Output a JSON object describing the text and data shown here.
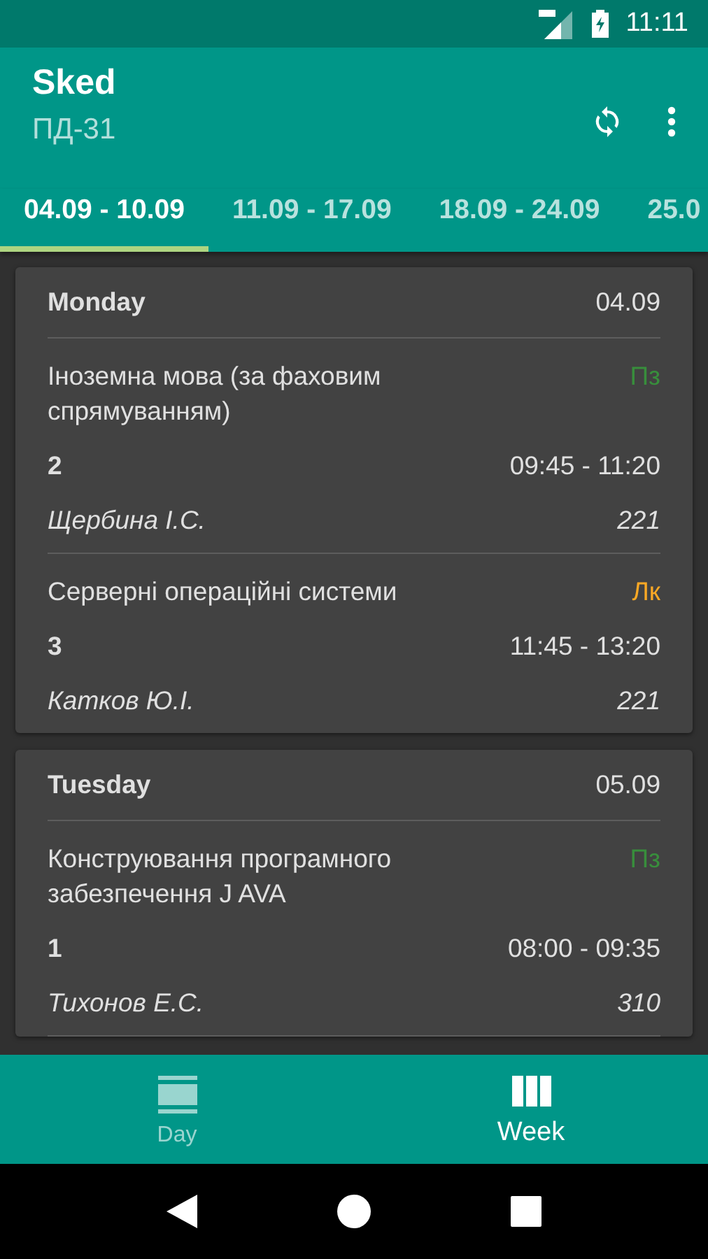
{
  "status_bar": {
    "time": "11:11"
  },
  "app_bar": {
    "title": "Sked",
    "subtitle": "ПД-31"
  },
  "tabs": [
    {
      "label": "04.09 - 10.09",
      "selected": true
    },
    {
      "label": "11.09 - 17.09",
      "selected": false
    },
    {
      "label": "18.09 - 24.09",
      "selected": false
    },
    {
      "label": "25.0",
      "selected": false
    }
  ],
  "days": [
    {
      "name": "Monday",
      "date": "04.09",
      "more_below": false,
      "lessons": [
        {
          "title": "Іноземна мова (за фаховим спрямуванням)",
          "type": "Пз",
          "color": "#388e3c",
          "number": "2",
          "time": "09:45 - 11:20",
          "teacher": "Щербина І.С.",
          "room": "221"
        },
        {
          "title": "Серверні операційні системи",
          "type": "Лк",
          "color": "#f9a825",
          "number": "3",
          "time": "11:45 - 13:20",
          "teacher": "Катков Ю.І.",
          "room": "221"
        }
      ]
    },
    {
      "name": "Tuesday",
      "date": "05.09",
      "more_below": true,
      "lessons": [
        {
          "title": "Конструювання програмного забезпечення  J AVA",
          "type": "Пз",
          "color": "#388e3c",
          "number": "1",
          "time": "08:00 - 09:35",
          "teacher": "Тихонов Е.С.",
          "room": "310"
        }
      ]
    }
  ],
  "bottom_nav": [
    {
      "label": "Day",
      "kind": "day",
      "selected": false
    },
    {
      "label": "Week",
      "kind": "week",
      "selected": true
    }
  ]
}
